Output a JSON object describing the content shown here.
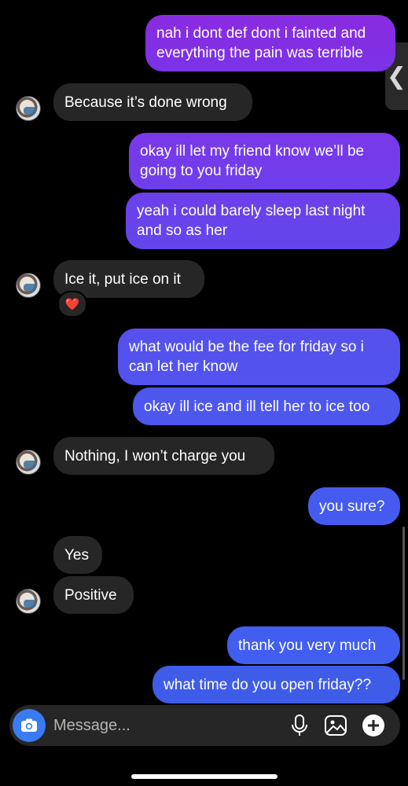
{
  "colors": {
    "background": "#000000",
    "incoming_bubble": "#262626",
    "outgoing_gradient_top": "#8a2be2",
    "outgoing_gradient_bottom": "#3f5ce8",
    "composer_bg": "#262626",
    "camera_button": "#3a7bf2"
  },
  "messages": [
    {
      "id": "m1",
      "sender": "me",
      "text": "nah i dont def dont i fainted and everything the pain was terrible"
    },
    {
      "id": "m2",
      "sender": "them",
      "text": "Because it’s done wrong"
    },
    {
      "id": "m3",
      "sender": "me",
      "text": "okay ill let my friend know we’ll be going to you friday"
    },
    {
      "id": "m4",
      "sender": "me",
      "text": "yeah i could barely sleep last night and so as her"
    },
    {
      "id": "m5",
      "sender": "them",
      "text": "Ice it, put ice on it",
      "reaction": "❤️"
    },
    {
      "id": "m6",
      "sender": "me",
      "text": "what would be the fee for friday so i can let her know"
    },
    {
      "id": "m7",
      "sender": "me",
      "text": "okay ill ice and ill tell her to ice too"
    },
    {
      "id": "m8",
      "sender": "them",
      "text": "Nothing, I won’t charge you"
    },
    {
      "id": "m9",
      "sender": "me",
      "text": "you sure?"
    },
    {
      "id": "m10",
      "sender": "them",
      "text": "Yes"
    },
    {
      "id": "m11",
      "sender": "them",
      "text": "Positive"
    },
    {
      "id": "m12",
      "sender": "me",
      "text": "thank you very much"
    },
    {
      "id": "m13",
      "sender": "me",
      "text": "what time do you open friday??"
    }
  ],
  "composer": {
    "placeholder": "Message...",
    "icons": [
      "camera-icon",
      "microphone-icon",
      "gallery-icon",
      "plus-icon"
    ]
  },
  "side_handle": {
    "icon": "chevron-left-icon",
    "glyph": "❮"
  }
}
